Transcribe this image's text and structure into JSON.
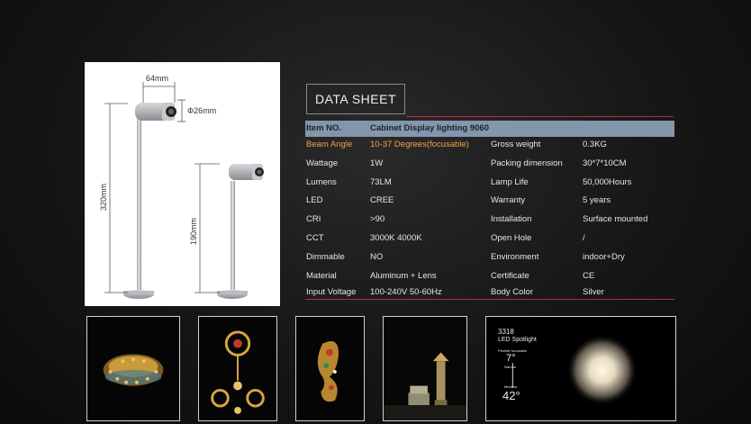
{
  "dimensions": {
    "width_label": "64mm",
    "diameter_label": "Φ26mm",
    "height_tall_label": "320mm",
    "height_short_label": "190mm"
  },
  "datasheet": {
    "title": "DATA SHEET",
    "header": {
      "col1": "Item NO.",
      "col2": "Cabinet Display lighting 9060"
    },
    "rows": [
      {
        "k1": "Beam Angle",
        "v1": "10-37 Degrees(focusable)",
        "k2": "Gross weight",
        "v2": "0.3KG"
      },
      {
        "k1": "Wattage",
        "v1": "1W",
        "k2": "Packing dimension",
        "v2": "30*7*10CM"
      },
      {
        "k1": "Lumens",
        "v1": "73LM",
        "k2": "Lamp Life",
        "v2": "50,000Hours"
      },
      {
        "k1": "LED",
        "v1": "CREE",
        "k2": "Warranty",
        "v2": "5 years"
      },
      {
        "k1": "CRI",
        "v1": ">90",
        "k2": "Installation",
        "v2": "Surface mounted"
      },
      {
        "k1": "CCT",
        "v1": "3000K 4000K",
        "k2": "Open Hole",
        "v2": "/"
      },
      {
        "k1": "Dimmable",
        "v1": "NO",
        "k2": "Environment",
        "v2": "indoor+Dry"
      },
      {
        "k1": "Material",
        "v1": "Aluminum + Lens",
        "k2": "Certificate",
        "v2": "CE"
      },
      {
        "k1": "Input Voltage",
        "v1": "100-240V 50-60Hz",
        "k2": "Body Color",
        "v2": "Silver"
      }
    ]
  },
  "spotlight_card": {
    "model": "3318",
    "name": "LED Spotlight",
    "sub": "Flexible focusable",
    "angle_narrow": "7°",
    "label_narrow": "Narrow",
    "label_medium": "Medium",
    "angle_wide": "42°"
  },
  "colors": {
    "accent_line": "#b0303a",
    "header_bg": "#8496ab",
    "highlight": "#f2a13a"
  }
}
